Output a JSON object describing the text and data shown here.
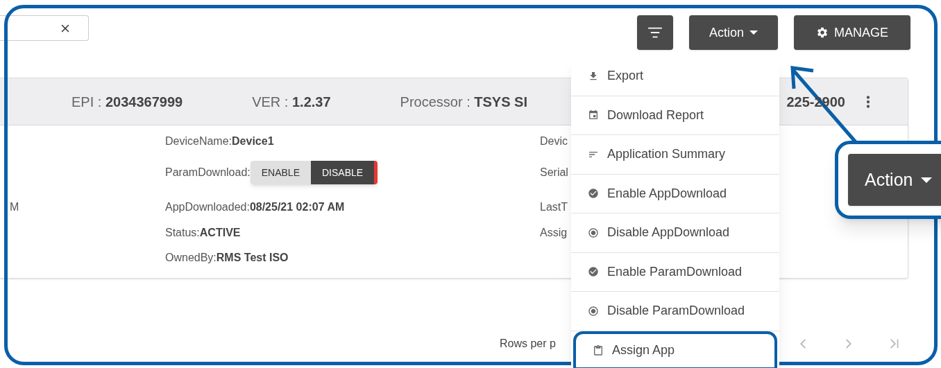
{
  "toolbar": {
    "action_button": "Action",
    "manage_button": "MANAGE"
  },
  "device_card": {
    "header": [
      {
        "label": "EPI :",
        "value": "2034367999"
      },
      {
        "label": "VER :",
        "value": "1.2.37"
      },
      {
        "label": "Processor :",
        "value": "TSYS SI"
      }
    ],
    "header_fragment": "225-2900",
    "rows": [
      {
        "middle": {
          "kind": "text",
          "label": "DeviceName:",
          "value": "Device1"
        },
        "right": "Devic"
      },
      {
        "middle": {
          "kind": "toggle",
          "label": "ParamDownload:",
          "options": [
            {
              "label": "ENABLE",
              "selected": false
            },
            {
              "label": "DISABLE",
              "selected": true
            }
          ]
        },
        "right": "Serial"
      },
      {
        "left": "M",
        "middle": {
          "kind": "text",
          "label": "AppDownloaded:",
          "value": "08/25/21 02:07 AM"
        },
        "right": "LastT"
      },
      {
        "middle": {
          "kind": "text",
          "label": "Status:",
          "value": "ACTIVE"
        },
        "right": "Assig"
      },
      {
        "middle": {
          "kind": "text",
          "label": "OwnedBy:",
          "value": "RMS Test ISO"
        }
      }
    ]
  },
  "action_menu": [
    {
      "kind": "download",
      "label": "Export",
      "highlighted": false
    },
    {
      "kind": "calendar",
      "label": "Download Report",
      "highlighted": false
    },
    {
      "kind": "list",
      "label": "Application Summary",
      "highlighted": false
    },
    {
      "kind": "check",
      "label": "Enable AppDownload",
      "highlighted": false
    },
    {
      "kind": "radio",
      "label": "Disable AppDownload",
      "highlighted": false
    },
    {
      "kind": "check",
      "label": "Enable ParamDownload",
      "highlighted": false
    },
    {
      "kind": "radio",
      "label": "Disable ParamDownload",
      "highlighted": false
    },
    {
      "kind": "clipboard",
      "label": "Assign App",
      "highlighted": true
    }
  ],
  "pagination": {
    "rows_per_page_label": "Rows per p"
  },
  "callout": {
    "button": "Action"
  }
}
